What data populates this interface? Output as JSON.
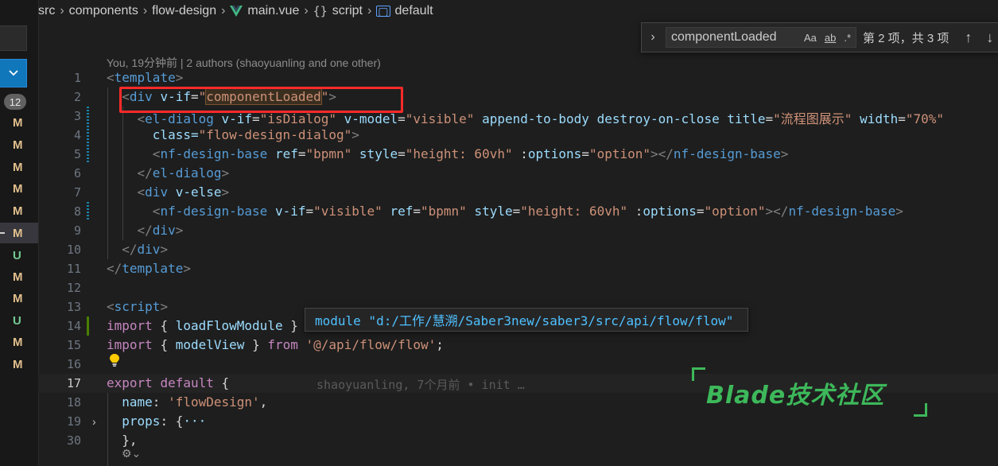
{
  "breadcrumb": {
    "items": [
      "src",
      "components",
      "flow-design"
    ],
    "file": "main.vue",
    "script": "script",
    "symbol": "default"
  },
  "sidebar": {
    "badge": "12",
    "scm_letters": [
      "M",
      "M",
      "M",
      "M",
      "M",
      "M",
      "U",
      "M",
      "M",
      "U",
      "M",
      "M"
    ]
  },
  "find_widget": {
    "query": "componentLoaded",
    "opt_case": "Aa",
    "opt_word": "ab",
    "opt_regex": ".*",
    "count": "第 2 项，共 3 项"
  },
  "blame_header": "You, 19分钟前 | 2 authors (shaoyuanling and one other)",
  "inline_blame": "shaoyuanling, 7个月前 • init …",
  "hover_text": "module \"d:/工作/慧溯/Saber3new/saber3/src/api/flow/flow\"",
  "watermark": "Blade技术社区",
  "lines": [
    {
      "n": "1",
      "text": "<template>"
    },
    {
      "n": "2",
      "text": "  <div v-if=\"componentLoaded\">"
    },
    {
      "n": "3",
      "text": "    <el-dialog v-if=\"isDialog\" v-model=\"visible\" append-to-body destroy-on-close title=\"流程图展示\" width=\"70%\""
    },
    {
      "n": "4",
      "text": "      class=\"flow-design-dialog\">"
    },
    {
      "n": "5",
      "text": "      <nf-design-base ref=\"bpmn\" style=\"height: 60vh\" :options=\"option\"></nf-design-base>"
    },
    {
      "n": "6",
      "text": "    </el-dialog>"
    },
    {
      "n": "7",
      "text": "    <div v-else>"
    },
    {
      "n": "8",
      "text": "      <nf-design-base v-if=\"visible\" ref=\"bpmn\" style=\"height: 60vh\" :options=\"option\"></nf-design-base>"
    },
    {
      "n": "9",
      "text": "    </div>"
    },
    {
      "n": "10",
      "text": "  </div>"
    },
    {
      "n": "11",
      "text": "</template>"
    },
    {
      "n": "12",
      "text": ""
    },
    {
      "n": "13",
      "text": "<script>"
    },
    {
      "n": "14",
      "text": "import { loadFlowModule }"
    },
    {
      "n": "15",
      "text": "import { modelView } from '@/api/flow/flow';"
    },
    {
      "n": "16",
      "text": ""
    },
    {
      "n": "17",
      "text": "export default {"
    },
    {
      "n": "18",
      "text": "  name: 'flowDesign',"
    },
    {
      "n": "19",
      "text": "  props: {···"
    },
    {
      "n": "30",
      "text": "  },"
    }
  ],
  "colors": {
    "tag": "#569cd6",
    "attr": "#9cdcfe",
    "string": "#ce9178",
    "keyword": "#c586c0",
    "modified": "#e2c08d",
    "untracked": "#73c991",
    "highlight_box": "#ff2a2a",
    "watermark": "#3db85a"
  }
}
